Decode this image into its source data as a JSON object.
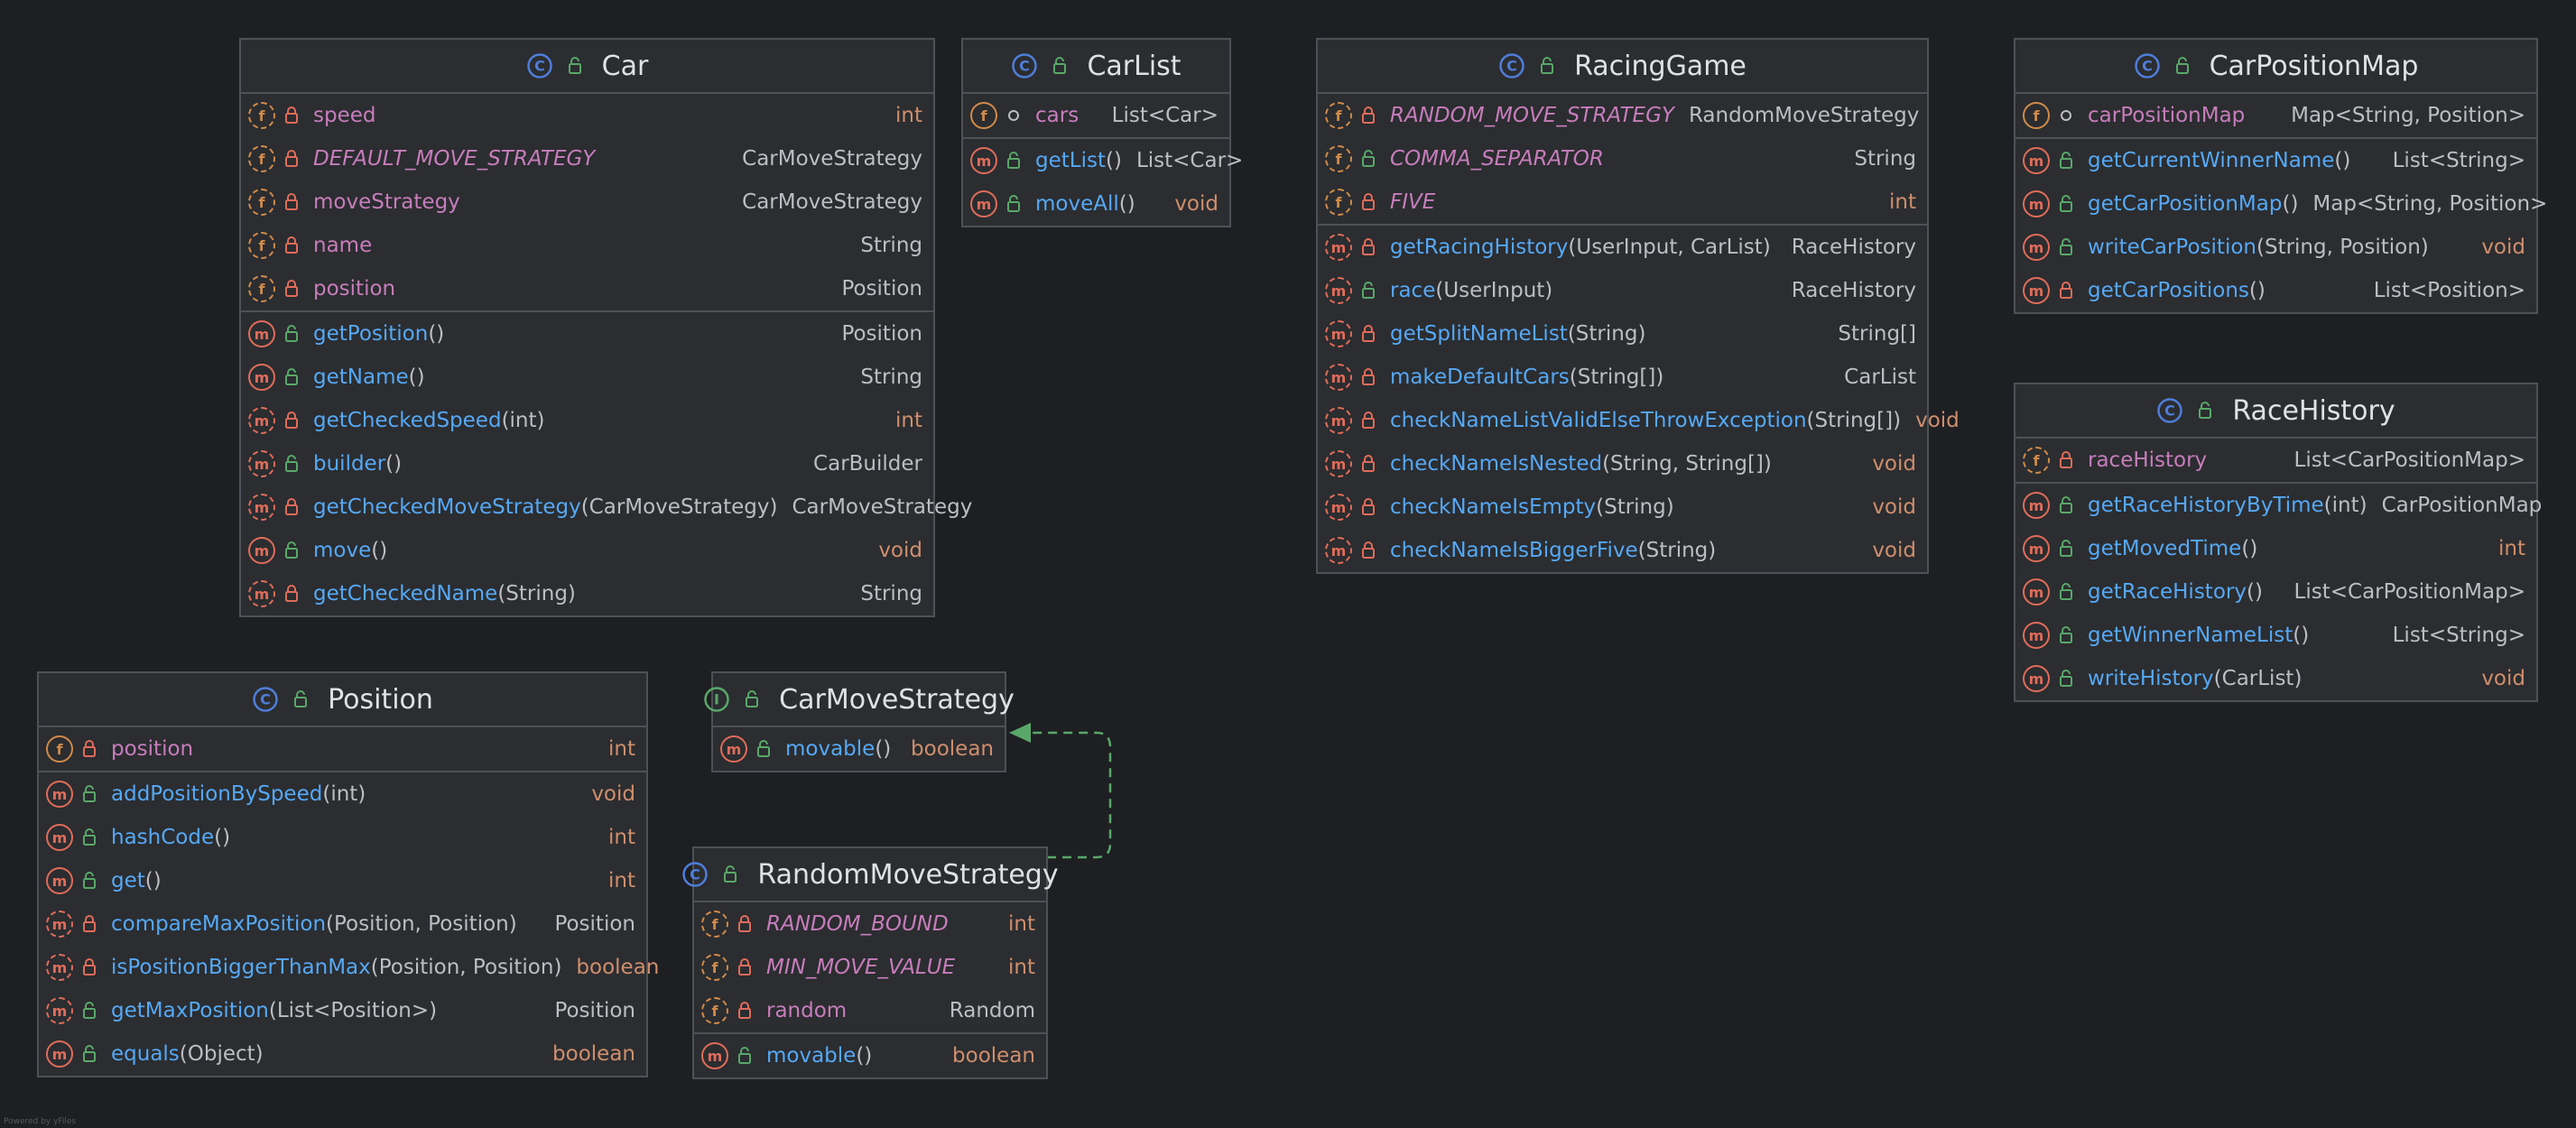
{
  "colors": {
    "background": "#1e1f22",
    "panel": "#2b2d30",
    "border": "#4e5157",
    "field_name": "#c77dbb",
    "method_name": "#56a8f5",
    "primitive_type": "#cf8e6d",
    "text": "#bcbec4",
    "class_icon": "#4f7dd9",
    "interface_icon": "#59a869",
    "method_icon": "#e06c5a",
    "field_icon": "#d08a4a",
    "public_vis": "#59a869",
    "private_vis": "#e06c5a",
    "realization_arrow": "#59a869"
  },
  "classes": [
    {
      "id": "Car",
      "title": "Car",
      "kind": "class",
      "fields": [
        {
          "name": "speed",
          "type": "int",
          "vis": "private",
          "final": true,
          "static": false,
          "primitive": true
        },
        {
          "name": "DEFAULT_MOVE_STRATEGY",
          "type": "CarMoveStrategy",
          "vis": "private",
          "final": true,
          "static": true,
          "primitive": false
        },
        {
          "name": "moveStrategy",
          "type": "CarMoveStrategy",
          "vis": "private",
          "final": true,
          "static": false,
          "primitive": false
        },
        {
          "name": "name",
          "type": "String",
          "vis": "private",
          "final": true,
          "static": false,
          "primitive": false
        },
        {
          "name": "position",
          "type": "Position",
          "vis": "private",
          "final": true,
          "static": false,
          "primitive": false
        }
      ],
      "methods": [
        {
          "name": "getPosition",
          "params": "()",
          "type": "Position",
          "vis": "public",
          "static": false,
          "primitive": false
        },
        {
          "name": "getName",
          "params": "()",
          "type": "String",
          "vis": "public",
          "static": false,
          "primitive": false
        },
        {
          "name": "getCheckedSpeed",
          "params": "(int)",
          "type": "int",
          "vis": "private",
          "static": true,
          "primitive": true
        },
        {
          "name": "builder",
          "params": "()",
          "type": "CarBuilder",
          "vis": "public",
          "static": true,
          "primitive": false
        },
        {
          "name": "getCheckedMoveStrategy",
          "params": "(CarMoveStrategy)",
          "type": "CarMoveStrategy",
          "vis": "private",
          "static": true,
          "primitive": false
        },
        {
          "name": "move",
          "params": "()",
          "type": "void",
          "vis": "public",
          "static": false,
          "primitive": true
        },
        {
          "name": "getCheckedName",
          "params": "(String)",
          "type": "String",
          "vis": "private",
          "static": true,
          "primitive": false
        }
      ]
    },
    {
      "id": "CarList",
      "title": "CarList",
      "kind": "class",
      "fields": [
        {
          "name": "cars",
          "type": "List<Car>",
          "vis": "package",
          "final": false,
          "static": false,
          "primitive": false
        }
      ],
      "methods": [
        {
          "name": "getList",
          "params": "()",
          "type": "List<Car>",
          "vis": "public",
          "static": false,
          "primitive": false
        },
        {
          "name": "moveAll",
          "params": "()",
          "type": "void",
          "vis": "public",
          "static": false,
          "primitive": true
        }
      ]
    },
    {
      "id": "RacingGame",
      "title": "RacingGame",
      "kind": "class",
      "fields": [
        {
          "name": "RANDOM_MOVE_STRATEGY",
          "type": "RandomMoveStrategy",
          "vis": "private",
          "final": true,
          "static": true,
          "primitive": false
        },
        {
          "name": "COMMA_SEPARATOR",
          "type": "String",
          "vis": "public",
          "final": true,
          "static": true,
          "primitive": false
        },
        {
          "name": "FIVE",
          "type": "int",
          "vis": "private",
          "final": true,
          "static": true,
          "primitive": true
        }
      ],
      "methods": [
        {
          "name": "getRacingHistory",
          "params": "(UserInput, CarList)",
          "type": "RaceHistory",
          "vis": "private",
          "static": true,
          "primitive": false
        },
        {
          "name": "race",
          "params": "(UserInput)",
          "type": "RaceHistory",
          "vis": "public",
          "static": true,
          "primitive": false
        },
        {
          "name": "getSplitNameList",
          "params": "(String)",
          "type": "String[]",
          "vis": "private",
          "static": true,
          "primitive": false
        },
        {
          "name": "makeDefaultCars",
          "params": "(String[])",
          "type": "CarList",
          "vis": "private",
          "static": true,
          "primitive": false
        },
        {
          "name": "checkNameListValidElseThrowException",
          "params": "(String[])",
          "type": "void",
          "vis": "private",
          "static": true,
          "primitive": true
        },
        {
          "name": "checkNameIsNested",
          "params": "(String, String[])",
          "type": "void",
          "vis": "private",
          "static": true,
          "primitive": true
        },
        {
          "name": "checkNameIsEmpty",
          "params": "(String)",
          "type": "void",
          "vis": "private",
          "static": true,
          "primitive": true
        },
        {
          "name": "checkNameIsBiggerFive",
          "params": "(String)",
          "type": "void",
          "vis": "private",
          "static": true,
          "primitive": true
        }
      ]
    },
    {
      "id": "CarPositionMap",
      "title": "CarPositionMap",
      "kind": "class",
      "fields": [
        {
          "name": "carPositionMap",
          "type": "Map<String, Position>",
          "vis": "package",
          "final": false,
          "static": false,
          "primitive": false
        }
      ],
      "methods": [
        {
          "name": "getCurrentWinnerName",
          "params": "()",
          "type": "List<String>",
          "vis": "public",
          "static": false,
          "primitive": false
        },
        {
          "name": "getCarPositionMap",
          "params": "()",
          "type": "Map<String, Position>",
          "vis": "public",
          "static": false,
          "primitive": false
        },
        {
          "name": "writeCarPosition",
          "params": "(String, Position)",
          "type": "void",
          "vis": "public",
          "static": false,
          "primitive": true
        },
        {
          "name": "getCarPositions",
          "params": "()",
          "type": "List<Position>",
          "vis": "private",
          "static": false,
          "primitive": false
        }
      ]
    },
    {
      "id": "RaceHistory",
      "title": "RaceHistory",
      "kind": "class",
      "fields": [
        {
          "name": "raceHistory",
          "type": "List<CarPositionMap>",
          "vis": "private",
          "final": true,
          "static": false,
          "primitive": false
        }
      ],
      "methods": [
        {
          "name": "getRaceHistoryByTime",
          "params": "(int)",
          "type": "CarPositionMap",
          "vis": "public",
          "static": false,
          "primitive": false
        },
        {
          "name": "getMovedTime",
          "params": "()",
          "type": "int",
          "vis": "public",
          "static": false,
          "primitive": true
        },
        {
          "name": "getRaceHistory",
          "params": "()",
          "type": "List<CarPositionMap>",
          "vis": "public",
          "static": false,
          "primitive": false
        },
        {
          "name": "getWinnerNameList",
          "params": "()",
          "type": "List<String>",
          "vis": "public",
          "static": false,
          "primitive": false
        },
        {
          "name": "writeHistory",
          "params": "(CarList)",
          "type": "void",
          "vis": "public",
          "static": false,
          "primitive": true
        }
      ]
    },
    {
      "id": "Position",
      "title": "Position",
      "kind": "class",
      "fields": [
        {
          "name": "position",
          "type": "int",
          "vis": "private",
          "final": false,
          "static": false,
          "primitive": true
        }
      ],
      "methods": [
        {
          "name": "addPositionBySpeed",
          "params": "(int)",
          "type": "void",
          "vis": "public",
          "static": false,
          "primitive": true
        },
        {
          "name": "hashCode",
          "params": "()",
          "type": "int",
          "vis": "public",
          "static": false,
          "primitive": true
        },
        {
          "name": "get",
          "params": "()",
          "type": "int",
          "vis": "public",
          "static": false,
          "primitive": true
        },
        {
          "name": "compareMaxPosition",
          "params": "(Position, Position)",
          "type": "Position",
          "vis": "private",
          "static": true,
          "primitive": false
        },
        {
          "name": "isPositionBiggerThanMax",
          "params": "(Position, Position)",
          "type": "boolean",
          "vis": "private",
          "static": true,
          "primitive": true
        },
        {
          "name": "getMaxPosition",
          "params": "(List<Position>)",
          "type": "Position",
          "vis": "public",
          "static": true,
          "primitive": false
        },
        {
          "name": "equals",
          "params": "(Object)",
          "type": "boolean",
          "vis": "public",
          "static": false,
          "primitive": true
        }
      ]
    },
    {
      "id": "CarMoveStrategy",
      "title": "CarMoveStrategy",
      "kind": "interface",
      "fields": [],
      "methods": [
        {
          "name": "movable",
          "params": "()",
          "type": "boolean",
          "vis": "public",
          "static": false,
          "primitive": true
        }
      ]
    },
    {
      "id": "RandomMoveStrategy",
      "title": "RandomMoveStrategy",
      "kind": "class",
      "fields": [
        {
          "name": "RANDOM_BOUND",
          "type": "int",
          "vis": "private",
          "final": true,
          "static": true,
          "primitive": true
        },
        {
          "name": "MIN_MOVE_VALUE",
          "type": "int",
          "vis": "private",
          "final": true,
          "static": true,
          "primitive": true
        },
        {
          "name": "random",
          "type": "Random",
          "vis": "private",
          "final": true,
          "static": false,
          "primitive": false
        }
      ],
      "methods": [
        {
          "name": "movable",
          "params": "()",
          "type": "boolean",
          "vis": "public",
          "static": false,
          "primitive": true
        }
      ]
    }
  ],
  "relations": [
    {
      "from": "RandomMoveStrategy",
      "to": "CarMoveStrategy",
      "kind": "realization"
    }
  ],
  "footer_note": "Powered by yFiles"
}
